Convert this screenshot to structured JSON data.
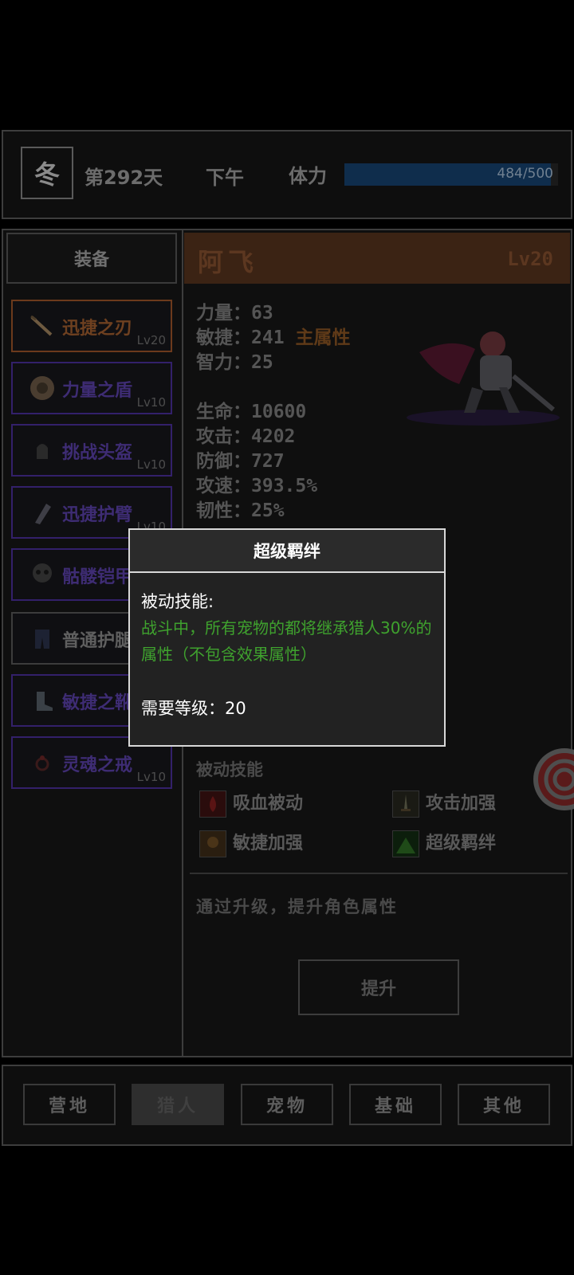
{
  "topbar": {
    "season": "冬",
    "day": "第292天",
    "time_of_day": "下午",
    "stamina_label": "体力",
    "stamina_text": "484/500",
    "stamina_fraction": 0.968
  },
  "equipment": {
    "tab_label": "装备",
    "items": [
      {
        "name": "迅捷之刃",
        "level": "Lv20",
        "icon": "blade-icon"
      },
      {
        "name": "力量之盾",
        "level": "Lv10",
        "icon": "shield-icon"
      },
      {
        "name": "挑战头盔",
        "level": "Lv10",
        "icon": "helmet-icon"
      },
      {
        "name": "迅捷护臂",
        "level": "Lv10",
        "icon": "bracer-icon"
      },
      {
        "name": "骷髅铠甲",
        "level": "",
        "icon": "skull-armor-icon"
      },
      {
        "name": "普通护腿",
        "level": "",
        "icon": "leggings-icon"
      },
      {
        "name": "敏捷之靴",
        "level": "",
        "icon": "boots-icon"
      },
      {
        "name": "灵魂之戒",
        "level": "Lv10",
        "icon": "ring-icon"
      }
    ]
  },
  "hero": {
    "name": "阿飞",
    "level": "Lv20",
    "stats": {
      "strength": "力量：63",
      "agility": "敏捷：241",
      "main_attr": "主属性",
      "intelligence": "智力：25",
      "hp": "生命：10600",
      "attack": "攻击：4202",
      "defense": "防御：727",
      "attack_speed": "攻速：393.5%",
      "tenacity": "韧性：25%"
    },
    "passive_title": "被动技能",
    "skills": [
      {
        "name": "吸血被动",
        "icon": "blood-icon"
      },
      {
        "name": "攻击加强",
        "icon": "sword-icon"
      },
      {
        "name": "敏捷加强",
        "icon": "agi-icon"
      },
      {
        "name": "超级羁绊",
        "icon": "bond-icon"
      }
    ],
    "upgrade_hint": "通过升级，提升角色属性",
    "upgrade_button": "提升"
  },
  "nav": {
    "items": [
      "营地",
      "猎人",
      "宠物",
      "基础",
      "其他"
    ],
    "active": "猎人"
  },
  "popup": {
    "title": "超级羁绊",
    "type": "被动技能:",
    "description": "战斗中，所有宠物的都将继承猎人30%的属性（不包含效果属性）",
    "requirement": "需要等级：20"
  },
  "colors": {
    "popup_desc": "#3fa22e",
    "hero_header": "#3b2314",
    "rare_border": "#33206a",
    "epic_border": "#6c3a1c"
  }
}
